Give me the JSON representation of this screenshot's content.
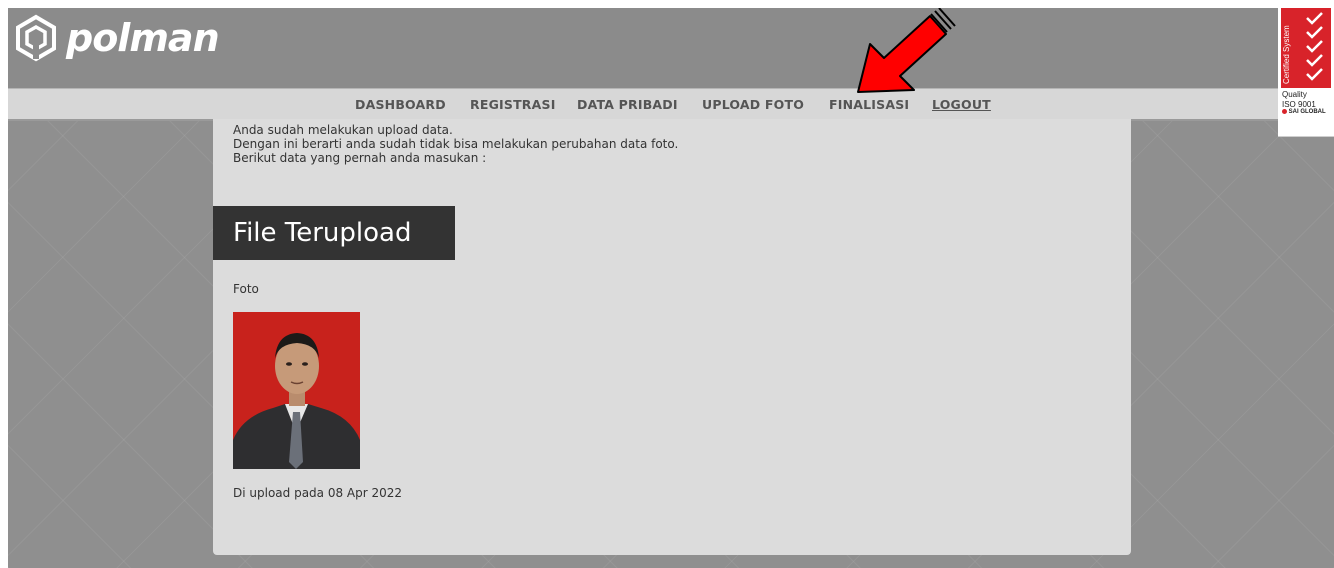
{
  "header": {
    "logo_text": "polman",
    "logo_icon": "polman-hexagon-logo-icon"
  },
  "nav": {
    "items": [
      {
        "label": "DASHBOARD"
      },
      {
        "label": "REGISTRASI"
      },
      {
        "label": "DATA PRIBADI"
      },
      {
        "label": "UPLOAD FOTO"
      },
      {
        "label": "FINALISASI"
      },
      {
        "label": "LOGOUT"
      }
    ]
  },
  "annotation": {
    "arrow_icon": "red-arrow-icon",
    "arrow_color": "#ff0000"
  },
  "iso_badge": {
    "vertical_text": "Certified System",
    "line1": "Quality",
    "line2": "ISO 9001",
    "line3": "SAI GLOBAL",
    "color": "#d8232a"
  },
  "content": {
    "message_lines": [
      "Anda sudah melakukan upload data.",
      "Dengan ini berarti anda sudah tidak bisa melakukan perubahan data foto.",
      "Berikut data yang pernah anda masukan :"
    ],
    "section_title": "File Terupload",
    "foto_label": "Foto",
    "upload_info": "Di upload pada 08 Apr 2022"
  },
  "colors": {
    "header_bg": "#8b8b8b",
    "nav_bg": "#d7d7d7",
    "panel_bg": "#dcdcdc",
    "section_title_bg": "#333333",
    "photo_bg": "#c8221c"
  }
}
